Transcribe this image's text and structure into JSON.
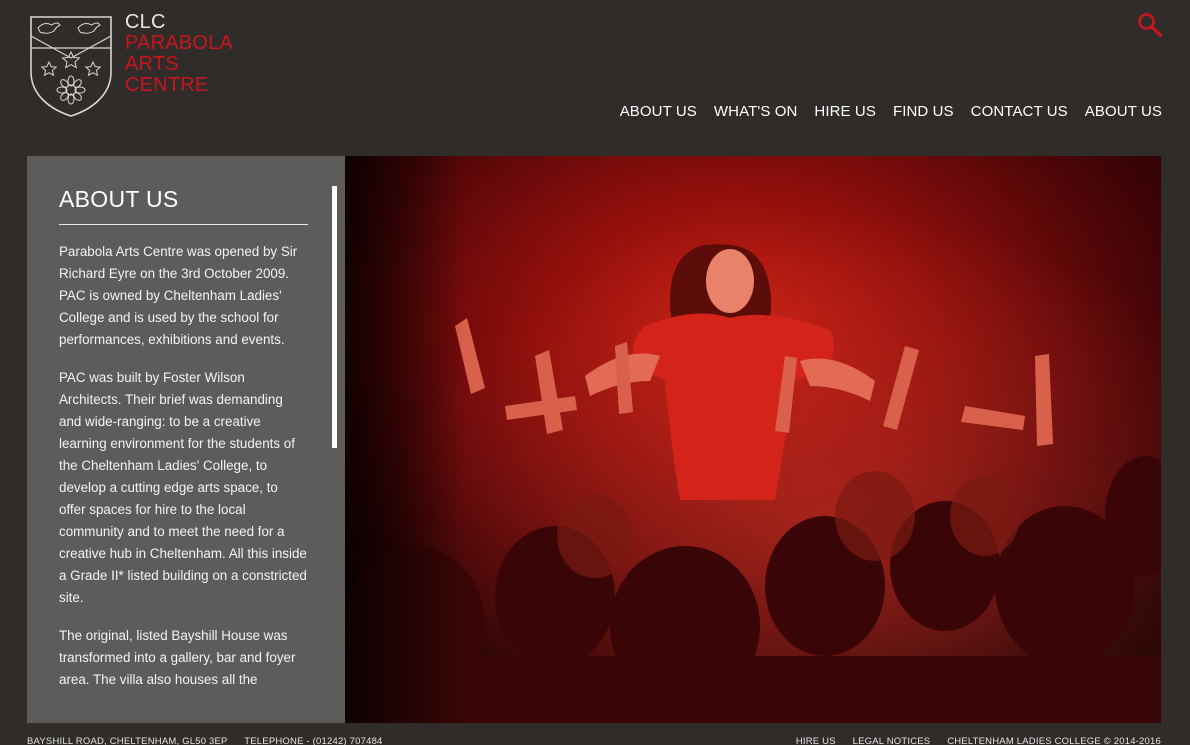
{
  "header": {
    "logo_line1": "CLC",
    "logo_line2": "PARABOLA",
    "logo_line3": "ARTS",
    "logo_line4": "CENTRE",
    "search_icon": "search-icon",
    "nav": [
      "ABOUT US",
      "WHAT'S ON",
      "HIRE US",
      "FIND US",
      "CONTACT US",
      "ABOUT US"
    ]
  },
  "panel": {
    "title": "ABOUT US",
    "paragraphs": [
      "Parabola Arts Centre was opened by Sir Richard Eyre on the 3rd October 2009. PAC is owned by Cheltenham Ladies' College and is used by the school for performances, exhibitions and events.",
      "PAC was built by Foster Wilson Architects. Their brief was demanding and wide-ranging: to be a creative learning environment for the students of the Cheltenham Ladies' College, to develop a cutting edge arts space, to offer spaces for hire to the local community and to meet the need for a creative hub in Cheltenham. All this inside a Grade II* listed building on a constricted site.",
      "The original, listed Bayshill House was transformed into a gallery, bar and foyer area. The villa also houses all the"
    ]
  },
  "footer": {
    "address": "BAYSHILL ROAD, CHELTENHAM, GL50 3EP",
    "telephone": "TELEPHONE - (01242) 707484",
    "hire_link": "HIRE US",
    "legal_link": "LEGAL NOTICES",
    "copyright": "CHELTENHAM LADIES COLLEGE © 2014-2016"
  },
  "colors": {
    "background": "#2f2c2a",
    "panel": "#5d5c5a",
    "brand_red": "#c8151d"
  }
}
